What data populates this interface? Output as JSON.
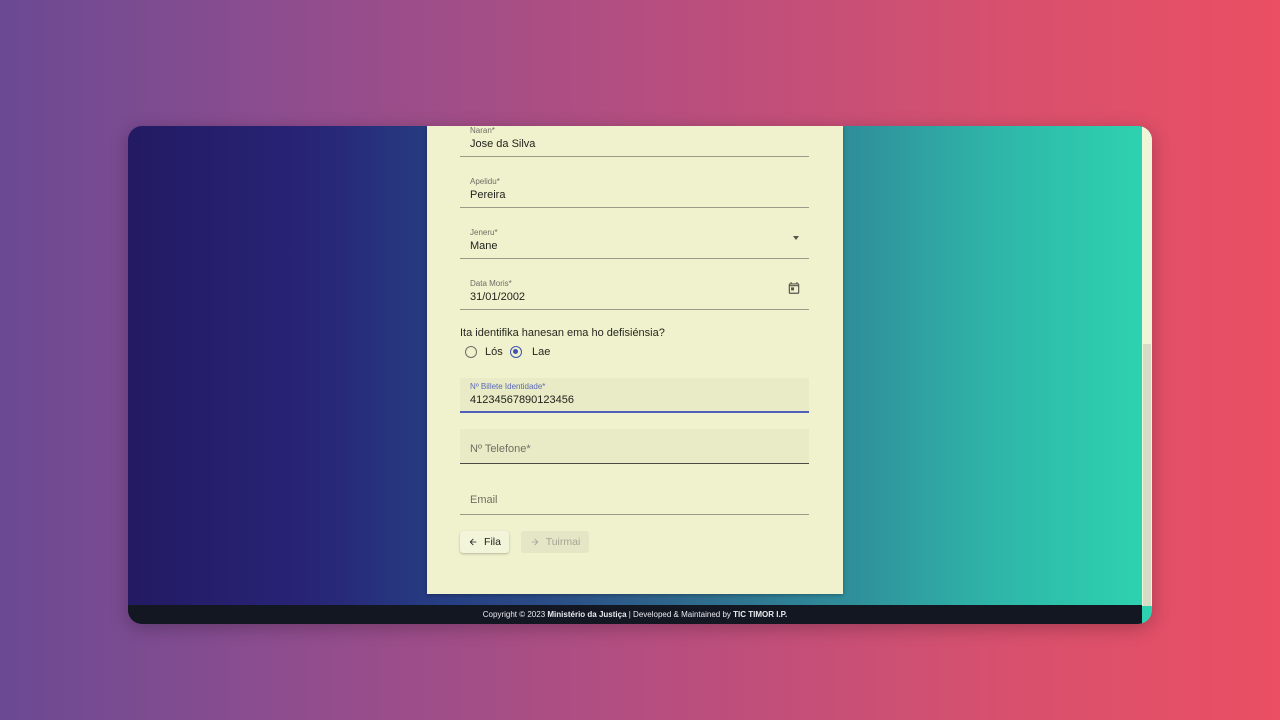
{
  "form": {
    "fields": [
      {
        "label": "Naran*",
        "value": "Jose da Silva"
      },
      {
        "label": "Apelidu*",
        "value": "Pereira"
      },
      {
        "label": "Jeneru*",
        "value": "Mane"
      },
      {
        "label": "Data Moris*",
        "value": "31/01/2002"
      }
    ],
    "question": "Ita identifika hanesan ema ho defisiénsia?",
    "radio_options": [
      {
        "label": "Lós",
        "checked": false
      },
      {
        "label": "Lae",
        "checked": true
      }
    ],
    "bi_field": {
      "label": "Nº Billete Identidade*",
      "value": "41234567890123456"
    },
    "phone_placeholder": "Nº Telefone*",
    "email_placeholder": "Email",
    "back_label": "Fila",
    "next_label": "Tuirmai"
  },
  "footer": {
    "copyright": "Copyright © 2023 ",
    "org": "Ministério da Justiça",
    "middle": " | Developed & Maintained by ",
    "maintainer": "TIC TIMOR I.P."
  },
  "colors": {
    "accent": "#3f51b5",
    "card": "#eff2cd",
    "footer": "#131722"
  },
  "icons": {
    "dropdown": "chevron-down-icon",
    "calendar": "calendar-icon",
    "back": "arrow-left-icon",
    "next": "arrow-right-icon"
  }
}
